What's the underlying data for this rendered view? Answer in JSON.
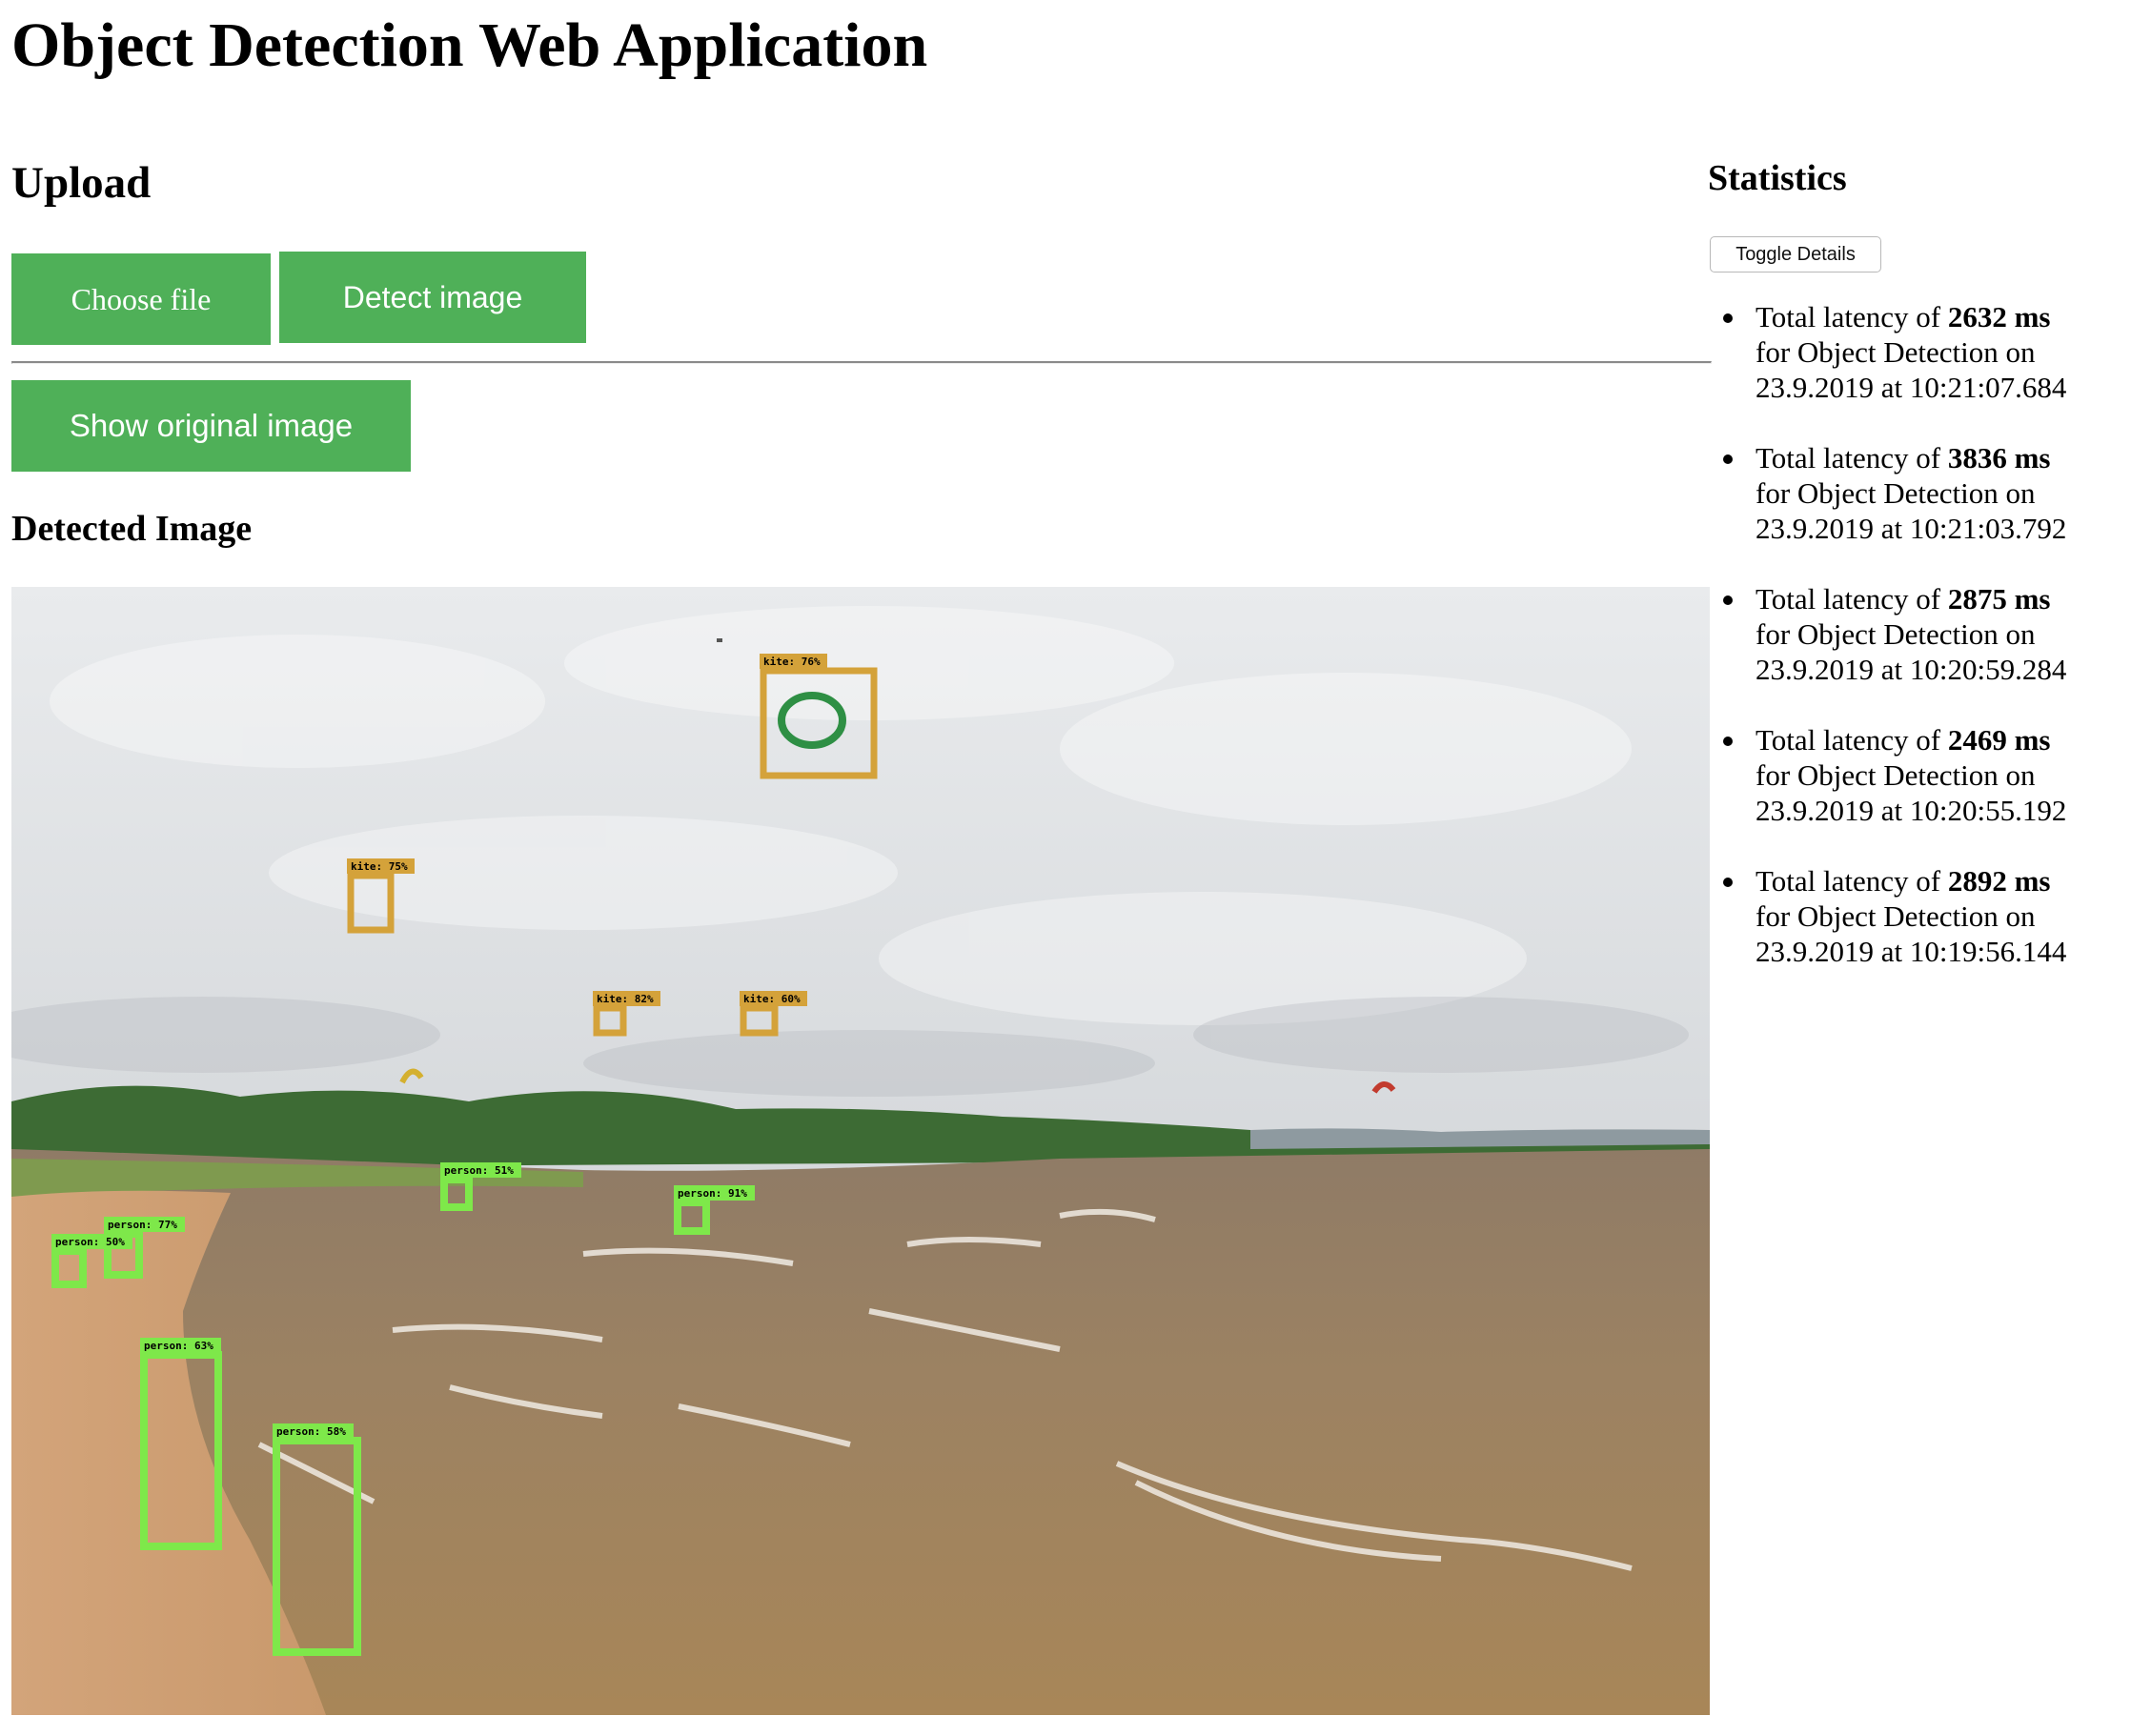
{
  "header": {
    "title": "Object Detection Web Application"
  },
  "upload": {
    "title": "Upload",
    "choose_file_label": "Choose file",
    "detect_label": "Detect image",
    "show_original_label": "Show original image",
    "detected_title": "Detected Image"
  },
  "detections": [
    {
      "label": "kite: 76%"
    },
    {
      "label": "kite: 75%"
    },
    {
      "label": "kite: 82%"
    },
    {
      "label": "kite: 60%"
    },
    {
      "label": "person: 51%"
    },
    {
      "label": "person: 91%"
    },
    {
      "label": "person: 77%"
    },
    {
      "label": "person: 50%"
    },
    {
      "label": "person: 63%"
    },
    {
      "label": "person: 58%"
    }
  ],
  "colors": {
    "button": "#4fb058",
    "kite_box": "#d4a23a",
    "person_box": "#7ee84a"
  },
  "statistics": {
    "title": "Statistics",
    "toggle_label": "Toggle Details",
    "items": [
      {
        "prefix": "Total latency of ",
        "value": "2632 ms",
        "suffix": "for Object Detection on",
        "timestamp": "23.9.2019 at 10:21:07.684"
      },
      {
        "prefix": "Total latency of ",
        "value": "3836 ms",
        "suffix": "for Object Detection on",
        "timestamp": "23.9.2019 at 10:21:03.792"
      },
      {
        "prefix": "Total latency of ",
        "value": "2875 ms",
        "suffix": "for Object Detection on",
        "timestamp": "23.9.2019 at 10:20:59.284"
      },
      {
        "prefix": "Total latency of ",
        "value": "2469 ms",
        "suffix": "for Object Detection on",
        "timestamp": "23.9.2019 at 10:20:55.192"
      },
      {
        "prefix": "Total latency of ",
        "value": "2892 ms",
        "suffix": "for Object Detection on",
        "timestamp": "23.9.2019 at 10:19:56.144"
      }
    ]
  }
}
